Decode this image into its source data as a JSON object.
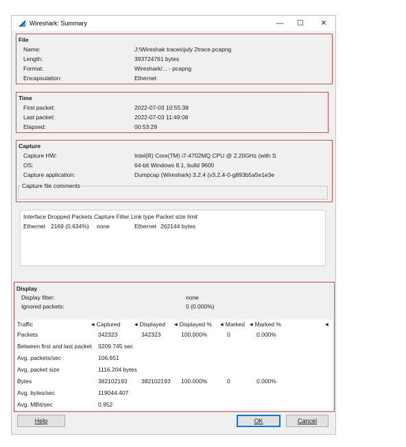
{
  "window": {
    "title": "Wireshark: Summary",
    "minimize_glyph": "—",
    "maximize_glyph": "☐",
    "close_glyph": "✕"
  },
  "file": {
    "title": "File",
    "rows": [
      {
        "label": "Name:",
        "value": "J:\\Wireshak traces\\july 2trace.pcapng"
      },
      {
        "label": "Length:",
        "value": "393724761 bytes"
      },
      {
        "label": "Format:",
        "value": "Wireshark/... - pcapng"
      },
      {
        "label": "Encapsulation:",
        "value": "Ethernet"
      }
    ]
  },
  "time": {
    "title": "Time",
    "rows": [
      {
        "label": "First packet:",
        "value": "2022-07-03 10:55:38"
      },
      {
        "label": "Last packet:",
        "value": "2022-07-03 11:49:08"
      },
      {
        "label": "Elapsed:",
        "value": "00:53:29"
      }
    ]
  },
  "capture": {
    "title": "Capture",
    "rows": [
      {
        "label": "Capture HW:",
        "value": "Intel(R) Core(TM) i7-4702MQ CPU @ 2.20GHz (with S"
      },
      {
        "label": "OS:",
        "value": "64-bit Windows 8.1, build 9600"
      },
      {
        "label": "Capture application:",
        "value": "Dumpcap (Wireshark) 3.2.4 (v3.2.4-0-g893b5a5e1e3e"
      }
    ],
    "comments_label": "Capture file comments"
  },
  "interfaces": {
    "header": "Interface Dropped Packets Capture Filter Link type Packet size limit",
    "row": {
      "interface": "Ethernet",
      "dropped": "2169 (0.634%)",
      "filter": "none",
      "link_type": "Ethernet",
      "size_limit": "262144 bytes"
    }
  },
  "display": {
    "title": "Display",
    "filter_label": "Display filter:",
    "filter_value": "none",
    "ignored_label": "Ignored packets:",
    "ignored_value": "0 (0.000%)"
  },
  "traffic": {
    "headers": [
      "Traffic",
      "Captured",
      "Displayed",
      "Displayed %",
      "Marked",
      "Marked %"
    ],
    "sort_glyph": "◀",
    "rows": [
      [
        "Packets",
        "342323",
        "342323",
        "100.000%",
        "0",
        "0.000%"
      ],
      [
        "Between first and last packet",
        "3209.745 sec",
        "",
        "",
        "",
        ""
      ],
      [
        "Avg. packets/sec",
        "106.651",
        "",
        "",
        "",
        ""
      ],
      [
        "Avg. packet size",
        "1116.204 bytes",
        "",
        "",
        "",
        ""
      ],
      [
        "Bytes",
        "382102193",
        "382102193",
        "100.000%",
        "0",
        "0.000%"
      ],
      [
        "Avg. bytes/sec",
        "119044.407",
        "",
        "",
        "",
        ""
      ],
      [
        "Avg. MBit/sec",
        "0.952",
        "",
        "",
        "",
        ""
      ]
    ]
  },
  "buttons": {
    "help": "Help",
    "ok": "OK",
    "cancel": "Cancel"
  },
  "colors": {
    "section_border": "#c0504d",
    "focus_border": "#0078d7",
    "shark_fin": "#1a5fb4"
  }
}
